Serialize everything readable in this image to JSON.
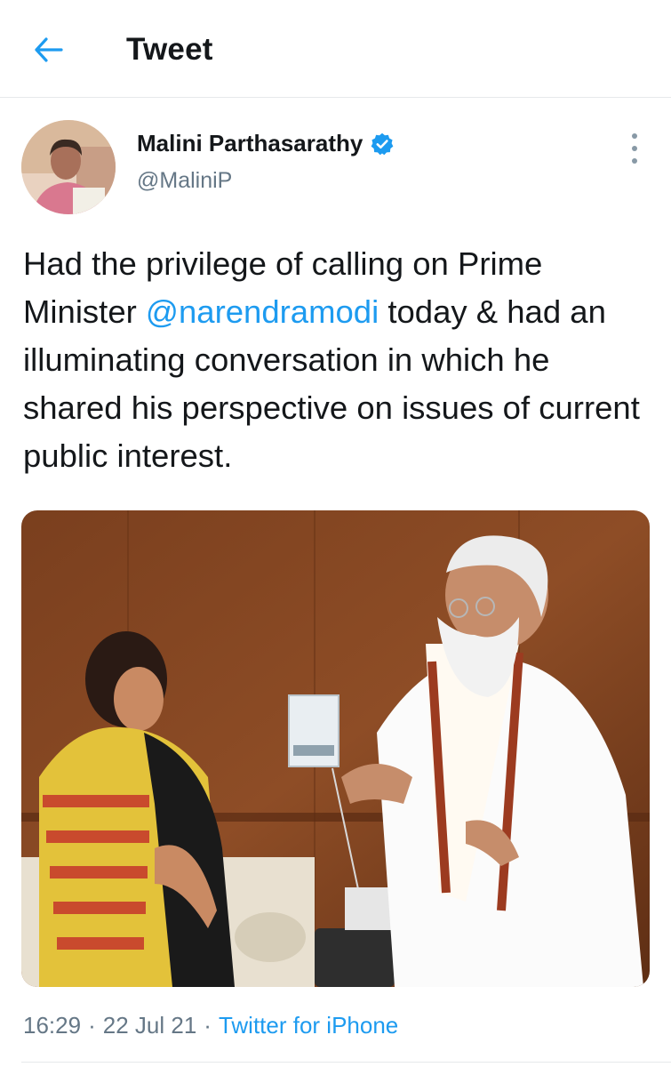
{
  "header": {
    "title": "Tweet",
    "back_icon": "arrow-left-icon"
  },
  "author": {
    "display_name": "Malini Parthasarathy",
    "handle": "@MaliniP",
    "verified_icon": "verified-badge-icon",
    "more_icon": "more-vertical-icon"
  },
  "tweet": {
    "text_before": "Had the privilege of calling on Prime Minister ",
    "mention": "@narendramodi",
    "text_after": " today & had an illuminating conversation in which he shared his perspective on issues of current public interest."
  },
  "meta": {
    "time": "16:29",
    "separator": "·",
    "date": "22 Jul 21",
    "source": "Twitter for iPhone"
  },
  "colors": {
    "accent": "#1d9bf0",
    "secondary_text": "#657786",
    "primary_text": "#14171a",
    "divider": "#e6e9eb"
  }
}
